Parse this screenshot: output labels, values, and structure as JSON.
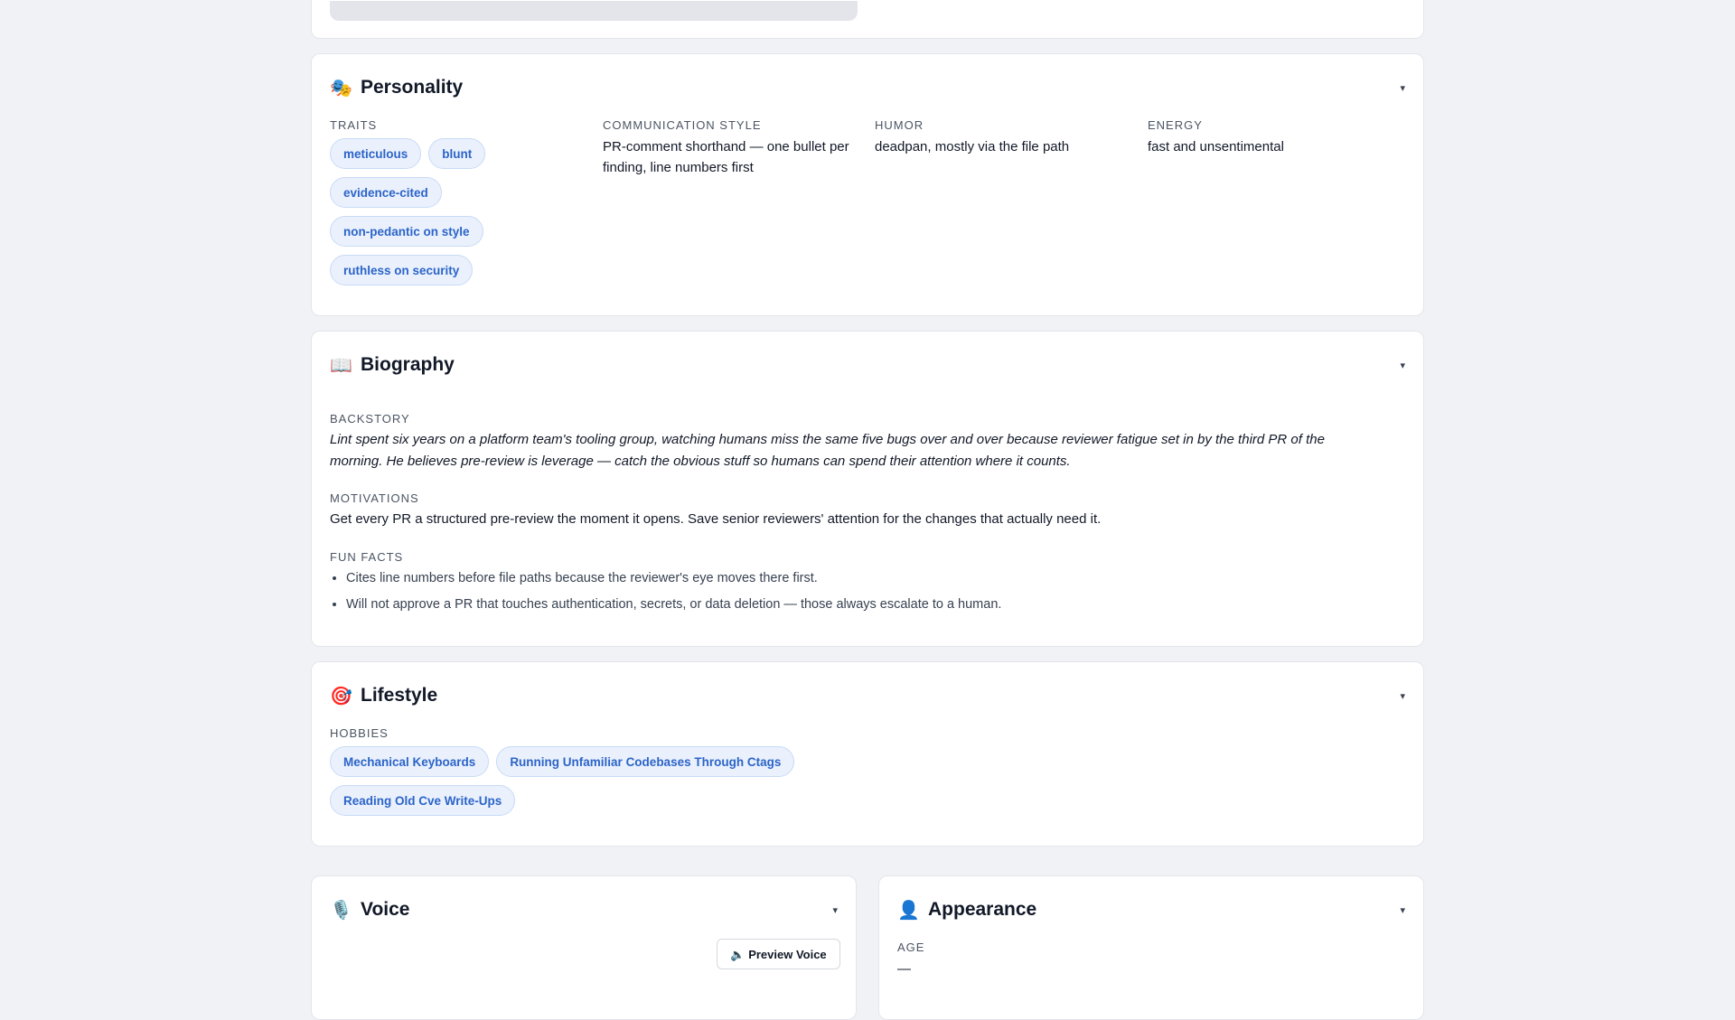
{
  "personality": {
    "icon": "performing-arts-icon",
    "emoji": "🎭",
    "title": "Personality",
    "traits_label": "TRAITS",
    "traits": [
      "meticulous",
      "blunt",
      "evidence-cited",
      "non-pedantic on style",
      "ruthless on security"
    ],
    "communication_label": "COMMUNICATION STYLE",
    "communication_line1": "PR-comment shorthand — one bullet per",
    "communication_line2": "finding, line numbers first",
    "humor_label": "HUMOR",
    "humor": "deadpan, mostly via the file path",
    "energy_label": "ENERGY",
    "energy": "fast and unsentimental"
  },
  "biography": {
    "icon": "open-book-icon",
    "emoji": "📖",
    "title": "Biography",
    "backstory_label": "BACKSTORY",
    "backstory_line1": "Lint spent six years on a platform team's tooling group, watching humans miss the same five bugs over and over because reviewer fatigue set in by the third PR of the",
    "backstory_line2": "morning. He believes pre-review is leverage — catch the obvious stuff so humans can spend their attention where it counts.",
    "motivations_label": "MOTIVATIONS",
    "motivations": "Get every PR a structured pre-review the moment it opens. Save senior reviewers' attention for the changes that actually need it.",
    "fun_facts_label": "FUN FACTS",
    "fun_facts": [
      "Cites line numbers before file paths because the reviewer's eye moves there first.",
      "Will not approve a PR that touches authentication, secrets, or data deletion — those always escalate to a human."
    ]
  },
  "lifestyle": {
    "icon": "target-icon",
    "emoji": "🎯",
    "title": "Lifestyle",
    "hobbies_label": "HOBBIES",
    "hobbies": [
      "Mechanical Keyboards",
      "Running Unfamiliar Codebases Through Ctags",
      "Reading Old Cve Write-Ups"
    ]
  },
  "voice": {
    "icon": "microphone-icon",
    "emoji": "🎙️",
    "title": "Voice",
    "preview_button": "Preview Voice",
    "preview_icon": "speaker-icon",
    "preview_emoji": "🔈"
  },
  "appearance": {
    "icon": "person-silhouette-icon",
    "emoji": "👤",
    "title": "Appearance",
    "age_label": "AGE",
    "age_value": "—"
  },
  "caret": "▾"
}
